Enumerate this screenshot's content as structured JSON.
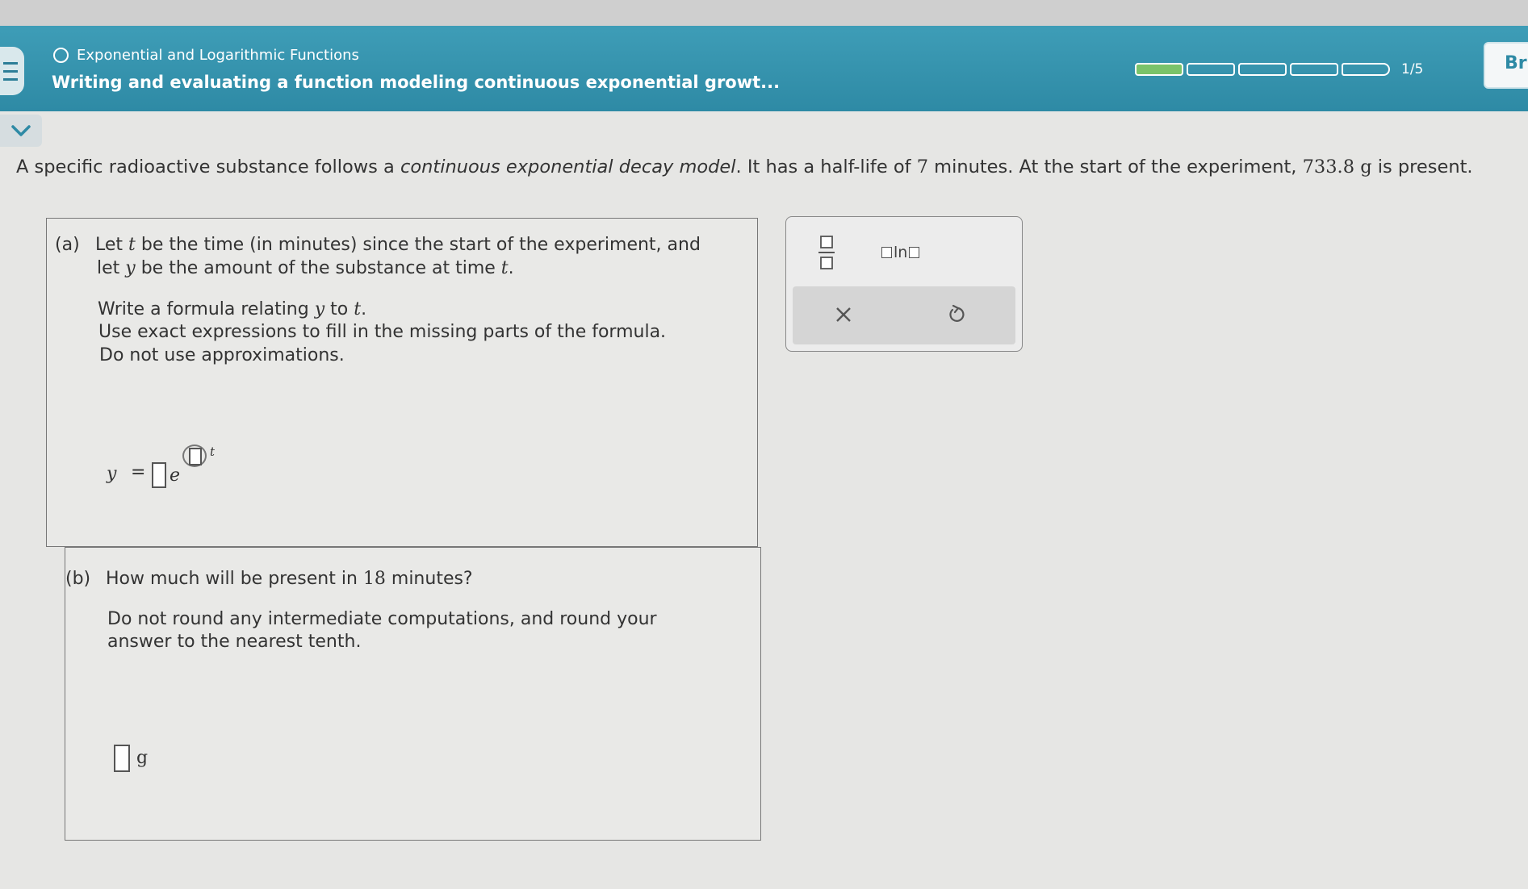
{
  "header": {
    "topic": "Exponential and Logarithmic Functions",
    "title": "Writing and evaluating a function modeling continuous exponential growt...",
    "progress": {
      "label": "1/5",
      "completed": 1,
      "total": 5
    },
    "right_button_label": "Br"
  },
  "problem": {
    "p1": "A specific radioactive substance follows a ",
    "p_em": "continuous exponential decay model",
    "p2": ". It has a half-life of ",
    "half_life": "7",
    "p3": " minutes. At the start of the experiment, ",
    "amount": "733.8",
    "unit": "g",
    "p4": " is present."
  },
  "part_a": {
    "label": "(a)",
    "line1_a": "Let ",
    "var_t": "t",
    "line1_b": " be the time (in minutes) since the start of the experiment, and",
    "line2_a": "let ",
    "var_y": "y",
    "line2_b": " be the amount of the substance at time ",
    "instr1_a": "Write a formula relating ",
    "instr1_b": " to ",
    "instr2": "Use exact expressions to fill in the missing parts of the formula.",
    "instr3": "Do not use approximations.",
    "formula_y": "y",
    "formula_eq": "=",
    "formula_e": "e",
    "formula_t": "t"
  },
  "part_b": {
    "label": "(b)",
    "q_a": "How much will be present in ",
    "minutes": "18",
    "q_b": " minutes?",
    "instr1": "Do not round any intermediate computations, and round your",
    "instr2": "answer to the nearest tenth.",
    "unit": "g"
  },
  "toolbox": {
    "ln_label": "ln"
  }
}
